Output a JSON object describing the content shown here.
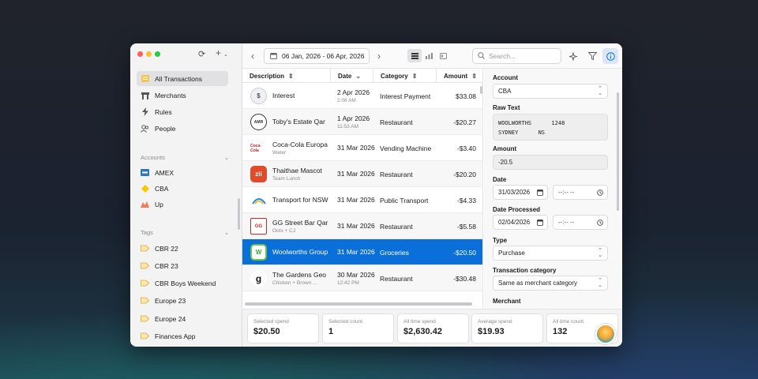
{
  "colors": {
    "accent": "#0a6fd8",
    "window": "#ffffff",
    "sidebar": "#f3f3f4"
  },
  "toolbar": {
    "date_range": "06 Jan, 2026 - 06 Apr, 2026",
    "search_placeholder": "Search..."
  },
  "sidebar": {
    "nav": [
      {
        "label": "All Transactions",
        "icon": "list-icon"
      },
      {
        "label": "Merchants",
        "icon": "store-icon"
      },
      {
        "label": "Rules",
        "icon": "bolt-icon"
      },
      {
        "label": "People",
        "icon": "people-icon"
      }
    ],
    "accounts_title": "Accounts",
    "accounts": [
      {
        "label": "AMEX"
      },
      {
        "label": "CBA"
      },
      {
        "label": "Up"
      }
    ],
    "tags_title": "Tags",
    "tags": [
      {
        "label": "CBR 22"
      },
      {
        "label": "CBR 23"
      },
      {
        "label": "CBR Boys Weekend"
      },
      {
        "label": "Europe 23"
      },
      {
        "label": "Europe 24"
      },
      {
        "label": "Finances App"
      }
    ]
  },
  "table": {
    "headers": {
      "description": "Description",
      "date": "Date",
      "category": "Category",
      "amount": "Amount"
    },
    "rows": [
      {
        "name": "Interest",
        "sub": "",
        "date": "2 Apr 2026",
        "time": "2:08 AM",
        "category": "Interest Payment",
        "amount": "$33.08",
        "logo": "$"
      },
      {
        "name": "Toby's Estate Qar",
        "sub": "",
        "date": "1 Apr 2026",
        "time": "11:53 AM",
        "category": "Restaurant",
        "amount": "-$20.27",
        "logo": "AMR"
      },
      {
        "name": "Coca-Cola Europa",
        "sub": "Water",
        "date": "31 Mar 2026",
        "time": "",
        "category": "Vending Machine",
        "amount": "-$3.40",
        "logo": "Coca-Cola"
      },
      {
        "name": "Thaithae Mascot",
        "sub": "Team Lunch",
        "date": "31 Mar 2026",
        "time": "",
        "category": "Restaurant",
        "amount": "-$20.20",
        "logo": "zii"
      },
      {
        "name": "Transport for NSW",
        "sub": "",
        "date": "31 Mar 2026",
        "time": "",
        "category": "Public Transport",
        "amount": "-$4.33",
        "logo": ""
      },
      {
        "name": "GG Street Bar Qar",
        "sub": "Oots + CJ",
        "date": "31 Mar 2026",
        "time": "",
        "category": "Restaurant",
        "amount": "-$5.58",
        "logo": "GG"
      },
      {
        "name": "Woolworths Group",
        "sub": "",
        "date": "31 Mar 2026",
        "time": "",
        "category": "Groceries",
        "amount": "-$20.50",
        "logo": "W"
      },
      {
        "name": "The Gardens Geo",
        "sub": "Chicken + Brown ...",
        "date": "30 Mar 2026",
        "time": "12:42 PM",
        "category": "Restaurant",
        "amount": "-$30.48",
        "logo": "g"
      }
    ]
  },
  "detail": {
    "account_label": "Account",
    "account_value": "CBA",
    "raw_label": "Raw Text",
    "raw_value": "WOOLWORTHS      1248\nSYDNEY      NS",
    "amount_label": "Amount",
    "amount_value": "-20.5",
    "date_label": "Date",
    "date_value": "31/03/2026",
    "time_placeholder": "--:-- --",
    "processed_label": "Date Processed",
    "processed_value": "02/04/2026",
    "type_label": "Type",
    "type_value": "Purchase",
    "txcat_label": "Transaction category",
    "txcat_value": "Same as merchant category",
    "merchant_label": "Merchant"
  },
  "stats": [
    {
      "label": "Selected spend",
      "value": "$20.50"
    },
    {
      "label": "Selected count",
      "value": "1"
    },
    {
      "label": "All time spend",
      "value": "$2,630.42"
    },
    {
      "label": "Average spend",
      "value": "$19.93"
    },
    {
      "label": "All time count",
      "value": "132"
    }
  ]
}
